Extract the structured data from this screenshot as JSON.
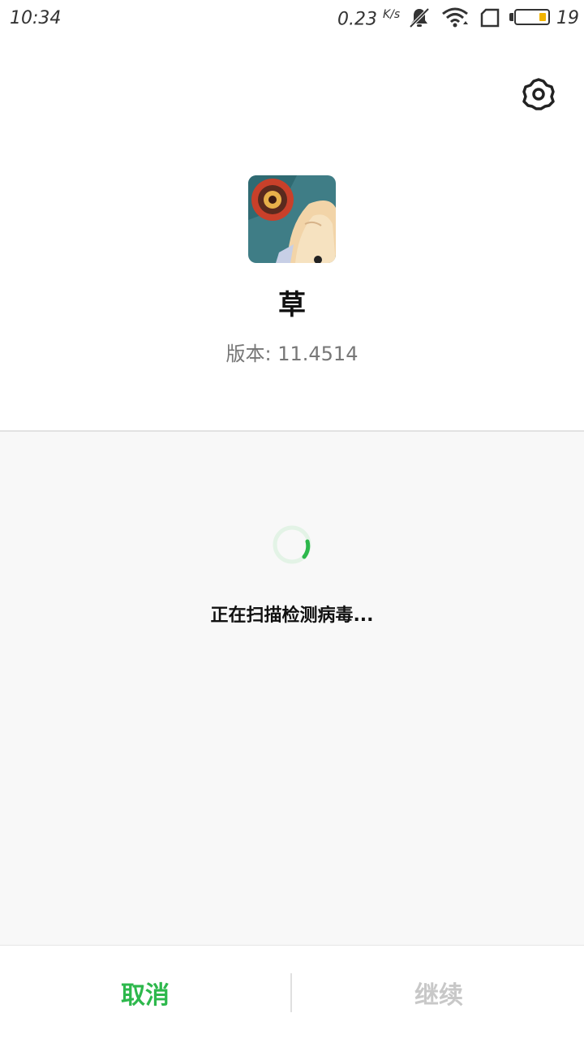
{
  "status_bar": {
    "time": "10:34",
    "net_speed": "0.23",
    "net_speed_unit": "K/s",
    "battery_level": "19",
    "icons": [
      "bell-muted-icon",
      "wifi-icon",
      "sim-icon",
      "battery-icon"
    ],
    "battery_color": "#f2b400"
  },
  "settings": {
    "icon": "gear-icon"
  },
  "app": {
    "name": "草",
    "version_text": "版本: 11.4514"
  },
  "scan": {
    "status_text": "正在扫描检测病毒...",
    "spinner_color": "#2db84c"
  },
  "actions": {
    "cancel_label": "取消",
    "continue_label": "继续",
    "cancel_color": "#2db84c",
    "continue_color": "#c8c8c8"
  }
}
